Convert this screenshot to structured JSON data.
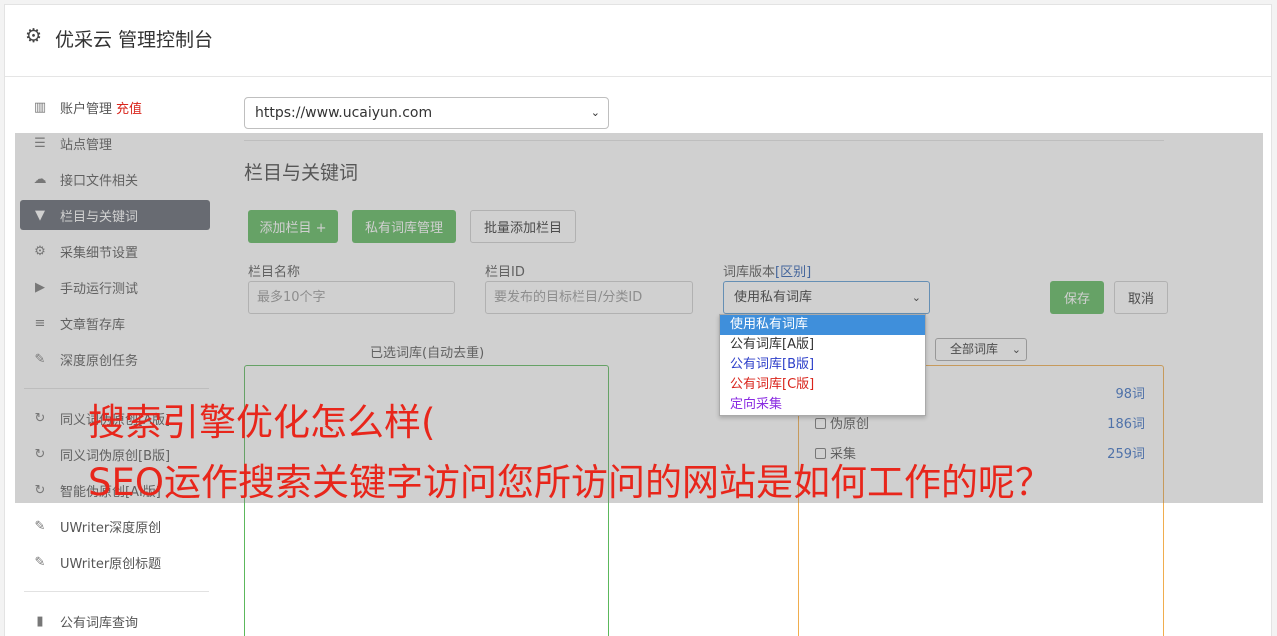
{
  "app": {
    "title": "优采云 管理控制台",
    "icon": "gear-icon"
  },
  "sidebar": {
    "items": [
      {
        "label": "账户管理",
        "badge": "充值",
        "icon": "bar-chart-icon"
      },
      {
        "label": "站点管理",
        "icon": "server-icon"
      },
      {
        "label": "接口文件相关",
        "icon": "cloud-upload-icon"
      },
      {
        "label": "栏目与关键词",
        "icon": "filter-icon",
        "active": true
      },
      {
        "label": "采集细节设置",
        "icon": "cogs-icon"
      },
      {
        "label": "手动运行测试",
        "icon": "play-circle-icon"
      },
      {
        "label": "文章暂存库",
        "icon": "database-icon"
      },
      {
        "label": "深度原创任务",
        "icon": "edit-icon"
      },
      {
        "label": "同义词伪原创[A版]",
        "icon": "refresh-icon"
      },
      {
        "label": "同义词伪原创[B版]",
        "icon": "refresh-icon"
      },
      {
        "label": "智能伪原创[AI版]",
        "icon": "refresh-icon"
      },
      {
        "label": "UWriter深度原创",
        "icon": "edit-icon"
      },
      {
        "label": "UWriter原创标题",
        "icon": "edit-icon"
      },
      {
        "label": "公有词库查询",
        "icon": "book-icon"
      }
    ]
  },
  "site_select": {
    "value": "https://www.ucaiyun.com"
  },
  "section": {
    "title": "栏目与关键词",
    "buttons": {
      "add": "添加栏目 +",
      "private_lib": "私有词库管理",
      "batch_add": "批量添加栏目"
    },
    "form": {
      "name_label": "栏目名称",
      "name_placeholder": "最多10个字",
      "id_label": "栏目ID",
      "id_placeholder": "要发布的目标栏目/分类ID",
      "lib_label": "词库版本",
      "lib_link": "[区别]",
      "lib_value": "使用私有词库",
      "save": "保存",
      "cancel": "取消"
    },
    "lib_options": [
      {
        "label": "使用私有词库",
        "color": "#ffffff"
      },
      {
        "label": "公有词库[A版]",
        "color": "#333333"
      },
      {
        "label": "公有词库[B版]",
        "color": "#2c3fc9"
      },
      {
        "label": "公有词库[C版]",
        "color": "#d9241b"
      },
      {
        "label": "定向采集",
        "color": "#8a2be2"
      }
    ],
    "selected_panel_title": "已选词库(自动去重)",
    "filter_value": "全部词库",
    "library_rows": [
      {
        "label": "",
        "count": "98词"
      },
      {
        "label": "伪原创",
        "count": "186词"
      },
      {
        "label": "采集",
        "count": "259词"
      }
    ]
  },
  "headline": {
    "line1": "搜索引擎优化怎么样(",
    "line2": "SEO运作搜索关键字访问您所访问的网站是如何工作的呢？"
  }
}
